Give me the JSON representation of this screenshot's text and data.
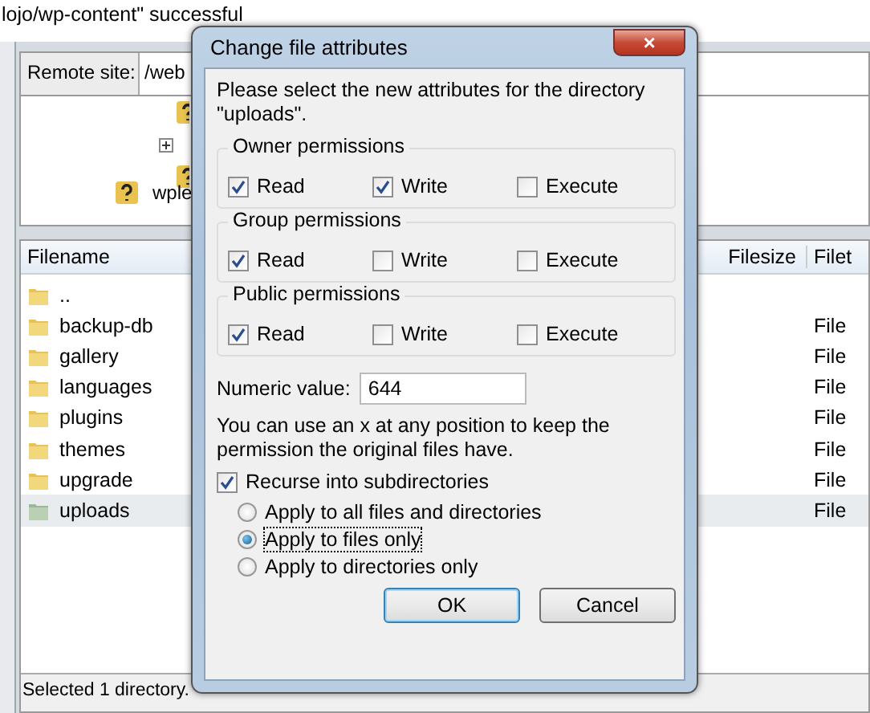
{
  "log_line": "lojo/wp-content\" successful",
  "remote_site": {
    "label": "Remote site:",
    "value": "/web"
  },
  "tree": [
    {
      "label": "wple"
    }
  ],
  "file_list": {
    "columns": [
      "Filename",
      "Filesize",
      "Filet"
    ],
    "rows": [
      {
        "name": "..",
        "type": "",
        "selected": false
      },
      {
        "name": "backup-db",
        "type": "File",
        "selected": false
      },
      {
        "name": "gallery",
        "type": "File",
        "selected": false
      },
      {
        "name": "languages",
        "type": "File",
        "selected": false
      },
      {
        "name": "plugins",
        "type": "File",
        "selected": false
      },
      {
        "name": "themes",
        "type": "File",
        "selected": false
      },
      {
        "name": "upgrade",
        "type": "File",
        "selected": false
      },
      {
        "name": "uploads",
        "type": "File",
        "selected": true
      }
    ]
  },
  "status_bar": "Selected 1 directory.",
  "dialog": {
    "title": "Change file attributes",
    "close": "×",
    "intro": "Please select the new attributes for the directory \"uploads\".",
    "groups": [
      {
        "title": "Owner permissions",
        "permissions": [
          {
            "label": "Read",
            "checked": true
          },
          {
            "label": "Write",
            "checked": true
          },
          {
            "label": "Execute",
            "checked": false
          }
        ]
      },
      {
        "title": "Group permissions",
        "permissions": [
          {
            "label": "Read",
            "checked": true
          },
          {
            "label": "Write",
            "checked": false
          },
          {
            "label": "Execute",
            "checked": false
          }
        ]
      },
      {
        "title": "Public permissions",
        "permissions": [
          {
            "label": "Read",
            "checked": true
          },
          {
            "label": "Write",
            "checked": false
          },
          {
            "label": "Execute",
            "checked": false
          }
        ]
      }
    ],
    "numeric": {
      "label": "Numeric value:",
      "value": "644"
    },
    "hint": "You can use an x at any position to keep the permission the original files have.",
    "recurse": {
      "label": "Recurse into subdirectories",
      "checked": true
    },
    "options": [
      {
        "label": "Apply to all files and directories",
        "selected": false
      },
      {
        "label": "Apply to files only",
        "selected": true
      },
      {
        "label": "Apply to directories only",
        "selected": false
      }
    ],
    "buttons": [
      {
        "label": "OK",
        "default": true
      },
      {
        "label": "Cancel",
        "default": false
      }
    ]
  }
}
